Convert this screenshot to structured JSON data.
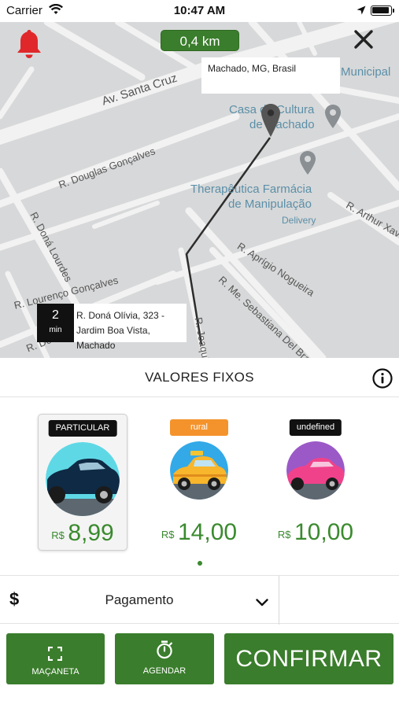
{
  "status_bar": {
    "carrier": "Carrier",
    "time": "10:47 AM"
  },
  "map": {
    "distance": "0,4 km",
    "destination": "Machado, MG, Brasil",
    "origin": {
      "minutes": "2",
      "minutes_unit": "min",
      "address_line1": "R. Doná Olívia, 323 -",
      "address_line2": "Jardim Boa Vista, Machado"
    },
    "streets": {
      "av_santa_cruz": "Av. Santa Cruz",
      "douglas": "R. Douglas Gonçalves",
      "dona_lourdes": "R. Doná Lourdes",
      "lourenco": "R. Lourenço Gonçalves",
      "aprigio": "R. Aprígio Nogueira",
      "sebastiana": "R. Me. Sebastiana Del Brand",
      "arthur": "R. Arthur Xav",
      "joaquim": "R. Joaquim",
      "dona_oli": "R. Doná Oli"
    },
    "pois": {
      "casa_cultura_1": "Casa da Cultura",
      "casa_cultura_2": "de Machado",
      "municipal": "Municipal",
      "farmacia_1": "Therapêutica Farmácia",
      "farmacia_2": "de Manipulação",
      "farmacia_3": "Delivery"
    }
  },
  "fixed_values": {
    "title": "VALORES FIXOS",
    "options": [
      {
        "tag": "PARTICULAR",
        "currency": "R$",
        "price": "8,99",
        "selected": true
      },
      {
        "tag": "rural",
        "currency": "R$",
        "price": "14,00",
        "selected": false
      },
      {
        "tag": "undefined",
        "currency": "R$",
        "price": "10,00",
        "selected": false
      }
    ]
  },
  "payment": {
    "symbol": "$",
    "label": "Pagamento"
  },
  "buttons": {
    "macaneta": "MAÇANETA",
    "agendar": "AGENDAR",
    "confirmar": "CONFIRMAR"
  },
  "colors": {
    "accent_green": "#3a7d2c",
    "price_green": "#3a8a2e",
    "orange_tag": "#f4932b",
    "bell_red": "#e0282b"
  },
  "icons": [
    "wifi-icon",
    "location-arrow-icon",
    "battery-icon",
    "bell-icon",
    "close-icon",
    "map-pin-icon",
    "info-icon",
    "chevron-down-icon",
    "expand-icon",
    "stopwatch-icon"
  ]
}
